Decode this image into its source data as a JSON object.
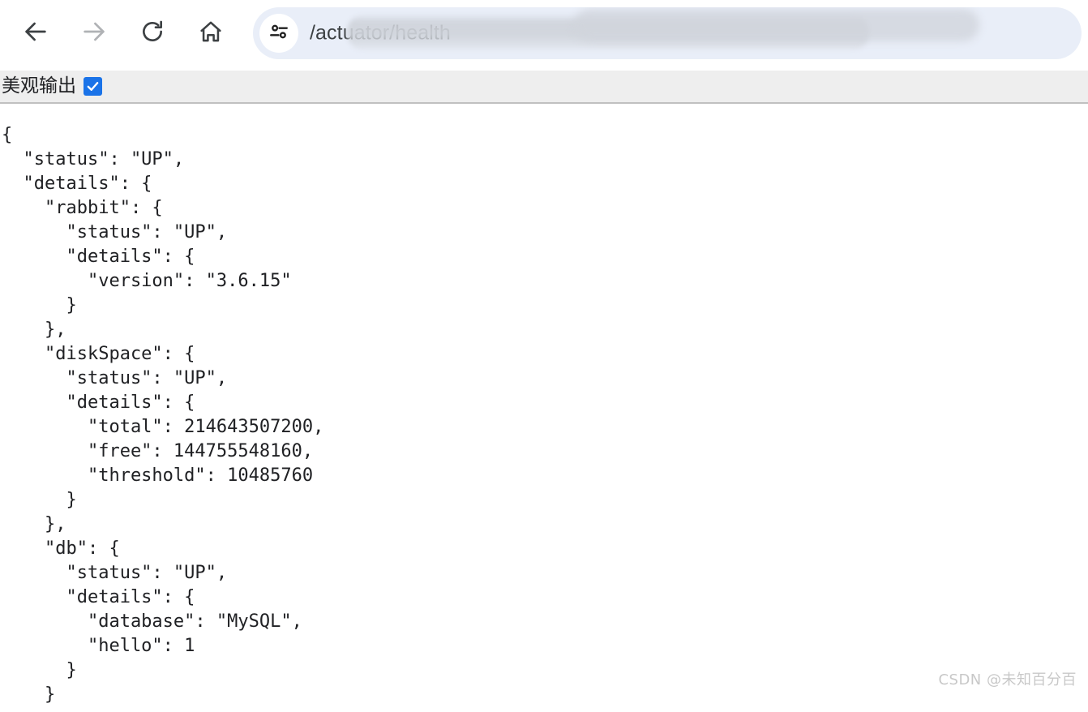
{
  "browser": {
    "nav": {
      "back_label": "Back",
      "back_icon": "arrow-left-icon",
      "forward_label": "Forward",
      "forward_icon": "arrow-right-icon",
      "reload_label": "Reload",
      "reload_icon": "reload-icon",
      "home_label": "Home",
      "home_icon": "home-icon"
    },
    "address_bar": {
      "site_settings_icon": "tune-sliders-icon",
      "url_visible_text": "/actuator/health",
      "url_redacted": true
    }
  },
  "viewer": {
    "pretty_print_label": "美观输出",
    "pretty_print_checked": true,
    "checkbox_color": "#1a73e8",
    "check_glyph": "✔"
  },
  "json_response": {
    "lines": [
      "{",
      "  \"status\": \"UP\",",
      "  \"details\": {",
      "    \"rabbit\": {",
      "      \"status\": \"UP\",",
      "      \"details\": {",
      "        \"version\": \"3.6.15\"",
      "      }",
      "    },",
      "    \"diskSpace\": {",
      "      \"status\": \"UP\",",
      "      \"details\": {",
      "        \"total\": 214643507200,",
      "        \"free\": 144755548160,",
      "        \"threshold\": 10485760",
      "      }",
      "    },",
      "    \"db\": {",
      "      \"status\": \"UP\",",
      "      \"details\": {",
      "        \"database\": \"MySQL\",",
      "        \"hello\": 1",
      "      }",
      "    }"
    ],
    "values": {
      "status": "UP",
      "rabbit_status": "UP",
      "rabbit_version": "3.6.15",
      "diskSpace_status": "UP",
      "diskSpace_total": "214643507200",
      "diskSpace_free": "144755548160",
      "diskSpace_threshold": "10485760",
      "db_status": "UP",
      "db_database": "MySQL",
      "db_hello": "1"
    }
  },
  "watermark": {
    "text": "CSDN @未知百分百"
  }
}
